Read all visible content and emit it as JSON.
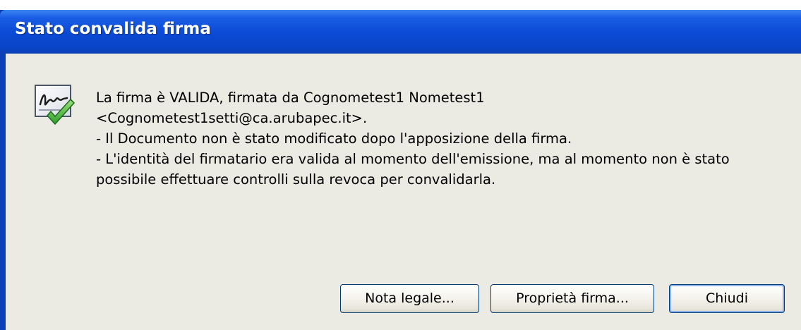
{
  "window": {
    "title": "Stato convalida firma"
  },
  "message": {
    "icon": "signature-valid-icon",
    "lines": [
      "La firma è VALIDA, firmata da Cognometest1 Nometest1",
      "<Cognometest1setti@ca.arubapec.it>.",
      "- Il Documento non è stato modificato dopo l'apposizione della firma.",
      "- L'identità del firmatario era valida al momento dell'emissione, ma al momento non è stato",
      "possibile effettuare controlli sulla revoca per convalidarla."
    ]
  },
  "buttons": {
    "legal_notice": "Nota legale...",
    "signature_properties": "Proprietà firma...",
    "close": "Chiudi"
  },
  "colors": {
    "titlebar": "#0b4ad4",
    "client_background": "#ecebe3",
    "check_green": "#2e9e2e"
  }
}
